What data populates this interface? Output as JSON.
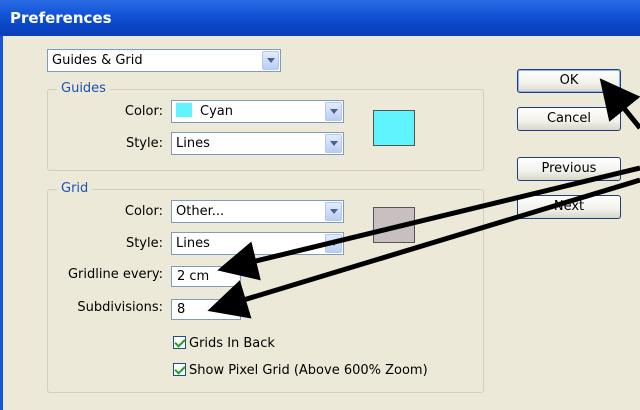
{
  "window": {
    "title": "Preferences"
  },
  "section": {
    "selected": "Guides & Grid"
  },
  "guides": {
    "group_label": "Guides",
    "color_label": "Color:",
    "color_value": "Cyan",
    "color_swatch": "#5ff4ff",
    "style_label": "Style:",
    "style_value": "Lines"
  },
  "grid": {
    "group_label": "Grid",
    "color_label": "Color:",
    "color_value": "Other...",
    "color_swatch": "#c8c0c0",
    "style_label": "Style:",
    "style_value": "Lines",
    "gridline_label": "Gridline every:",
    "gridline_value": "2 cm",
    "subdivisions_label": "Subdivisions:",
    "subdivisions_value": "8",
    "grids_in_back_label": "Grids In Back",
    "grids_in_back_checked": true,
    "pixel_grid_label": "Show Pixel Grid (Above 600% Zoom)",
    "pixel_grid_checked": true
  },
  "buttons": {
    "ok": "OK",
    "cancel": "Cancel",
    "previous": "Previous",
    "next": "Next"
  },
  "colors": {
    "title_bar": "#1557d8",
    "arrow": "#000000"
  }
}
